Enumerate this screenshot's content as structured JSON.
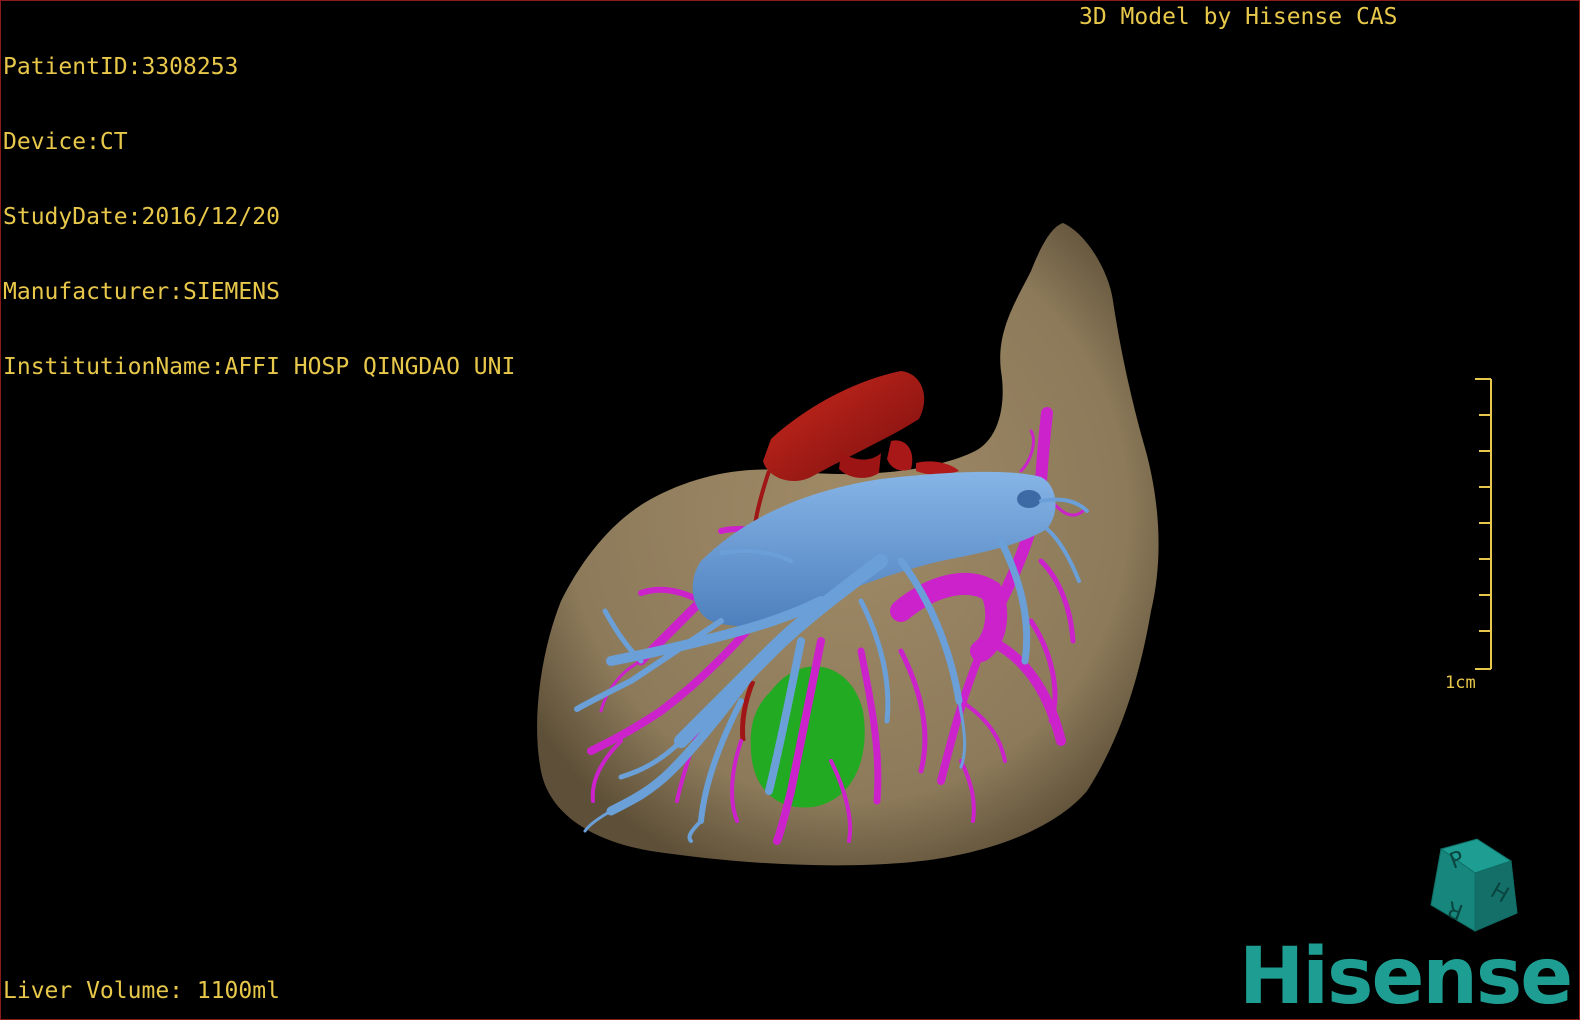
{
  "info": {
    "patient_id": "PatientID:3308253",
    "device": "Device:CT",
    "study_date": "StudyDate:2016/12/20",
    "manufacturer": "Manufacturer:SIEMENS",
    "institution": "InstitutionName:AFFI HOSP QINGDAO UNI"
  },
  "credit": "3D Model by Hisense CAS",
  "footer": {
    "liver_volume": "Liver Volume: 1100ml"
  },
  "scale": {
    "label": "1cm"
  },
  "logo": {
    "text": "Hisense"
  },
  "orientation_cube": {
    "faces": [
      "P",
      "H",
      "R"
    ]
  },
  "colors": {
    "overlay_text": "#e8c84a",
    "liver": "#8c7a5a",
    "portal_vein": "#6a9fd8",
    "hepatic_vein": "#cc22cc",
    "artery": "#b01a1a",
    "gallbladder": "#22aa22",
    "logo": "#1e9e92"
  }
}
